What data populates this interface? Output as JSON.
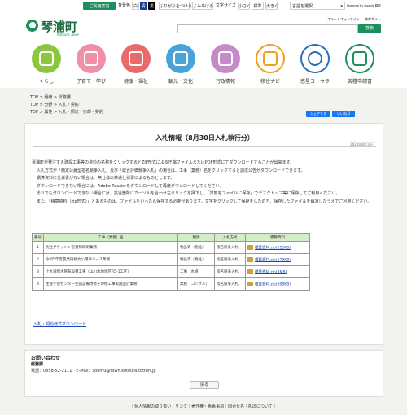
{
  "topbar": {
    "usage": "ご利用案内",
    "color_label": "背景色",
    "color_white": "白",
    "color_blue": "青",
    "color_black": "黒",
    "furigana": "ふりがなをつける",
    "readaloud": "よみあげる",
    "fontsize_label": "文字サイズ",
    "small": "小さく",
    "standard": "標準",
    "large": "大きく",
    "language": "言語を選択",
    "powered": "Powered by Google 翻訳"
  },
  "header": {
    "site_name": "琴浦町",
    "site_sub": "Kotoura Town",
    "link_smartphone": "スマートフォンサイト",
    "link_mobile": "携帯サイト",
    "search_placeholder": "",
    "search_button": "検索"
  },
  "nav": [
    {
      "label": "くらし",
      "color": "#8cc63f"
    },
    {
      "label": "子育て・学び",
      "color": "#ef8fa8"
    },
    {
      "label": "健康・福祉",
      "color": "#e96a6a"
    },
    {
      "label": "観光・文化",
      "color": "#4aa3d8"
    },
    {
      "label": "行政情報",
      "color": "#c48bc8"
    },
    {
      "label": "移住ナビ",
      "color": "#f0a020"
    },
    {
      "label": "感星コトウラ",
      "color": "#2a6fb8"
    },
    {
      "label": "各種申請書",
      "color": "#1c8f5c"
    }
  ],
  "breadcrumbs": [
    [
      "TOP",
      "組織",
      "総務課"
    ],
    [
      "TOP",
      "分野",
      "入札・契約"
    ],
    [
      "TOP",
      "属性",
      "入札・調達・売却・契約"
    ]
  ],
  "share": {
    "share_label": "シェアする",
    "like_label": "いいね 0"
  },
  "main": {
    "title": "入札情報（8月30日入札執行分）",
    "date": "2023年8月16日",
    "paragraphs": [
      "琴浦町が発注する建設工事等の資料の名称をクリックするとZIP形式による圧縮ファイルまたはPDF形式にてダウンロードすることが出来ます。",
      "入札方式が「簡定公募型指名競争入札」及び「総合評価競争入札」の場合は、工事（業務）名をクリックすると調達公告がダウンロードできます。",
      "積算資料に仕様書がない場合は、無仕様の共通仕様書によるものとします。",
      "ダウンロードできない場合には、Adobe Readerをダウンロードして再度ダウンロードしてください。",
      "それでもダウンロードできない場合には、該当箇所にカーソルを合わせ右クリックを押下し、「対象をファイルに保存」でデスクトップ等に保存してご利用ください。",
      "また、「積算資料（zip形式）」とあるものは、ファイルをいったん保存する必要があります。文字をクリックして保存をしたのち、保存したファイルを解凍したうえでご利用ください。"
    ],
    "table": {
      "headers": [
        "番号",
        "工事（業務）名",
        "種別",
        "入札方式",
        "積算資料"
      ],
      "rows": [
        {
          "no": "1",
          "name": "別注グラッシン窓封筒印刷業務",
          "type": "物品等（物品）",
          "method": "指名競争入札",
          "file": "積算資料.zip(215KB)"
        },
        {
          "no": "2",
          "name": "令和5年度農業研修文公用車リース業務",
          "type": "物品等（物品）",
          "method": "指名競争入札",
          "file": "積算資料.zip(179KB)"
        },
        {
          "no": "3",
          "name": "上水道配水管布設替工事（山川木地地区R5-1工区）",
          "type": "工事（水道）",
          "method": "指名競争入札",
          "file": "積算資料.zip(3MB)"
        },
        {
          "no": "4",
          "name": "生涯学習センター空調設備改修その他工事実施設計業務",
          "type": "業務（コンサル）",
          "method": "指名競争入札",
          "file": "積算資料.zip(608KB)"
        }
      ]
    },
    "bid_link": "入札・契約様式ダウンロード"
  },
  "contact": {
    "heading": "お問い合わせ",
    "dept": "総務課",
    "tel_email": "電話：0858-52-2111　E-Mail：soumu@town.kotoura.tottori.jp",
    "back": "戻る"
  },
  "footer": {
    "links": "｜個人情報の取り扱い｜リンク｜著作権・免責事項｜問合せ先｜RSSについて｜"
  }
}
